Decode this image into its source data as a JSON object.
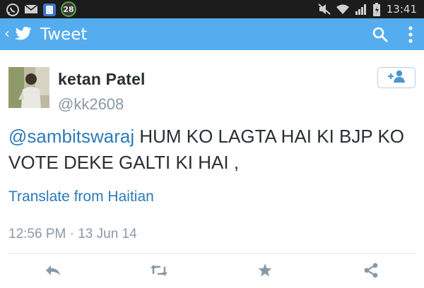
{
  "status_bar": {
    "notification_count": "28",
    "time": "13:41",
    "icons": [
      "whatsapp-icon",
      "email-icon",
      "app-icon",
      "notification-badge",
      "mute-icon",
      "wifi-icon",
      "signal-icon",
      "battery-icon"
    ]
  },
  "action_bar": {
    "back_symbol": "‹",
    "title": "Tweet",
    "icons": [
      "twitter-bird-icon",
      "search-icon",
      "overflow-menu-icon"
    ]
  },
  "tweet": {
    "author_name": "ketan Patel",
    "author_handle": "@kk2608",
    "mention": "@sambitswaraj",
    "text": " HUM KO LAGTA HAI KI BJP KO VOTE DEKE GALTI KI HAI ,",
    "translate_label": "Translate from Haitian",
    "timestamp": "12:56 PM · 13 Jun 14"
  },
  "actions": [
    "reply-icon",
    "retweet-icon",
    "favorite-icon",
    "share-icon"
  ],
  "colors": {
    "accent": "#55acee",
    "link": "#2b7bb9",
    "muted": "#8899a6",
    "text": "#292f33"
  }
}
